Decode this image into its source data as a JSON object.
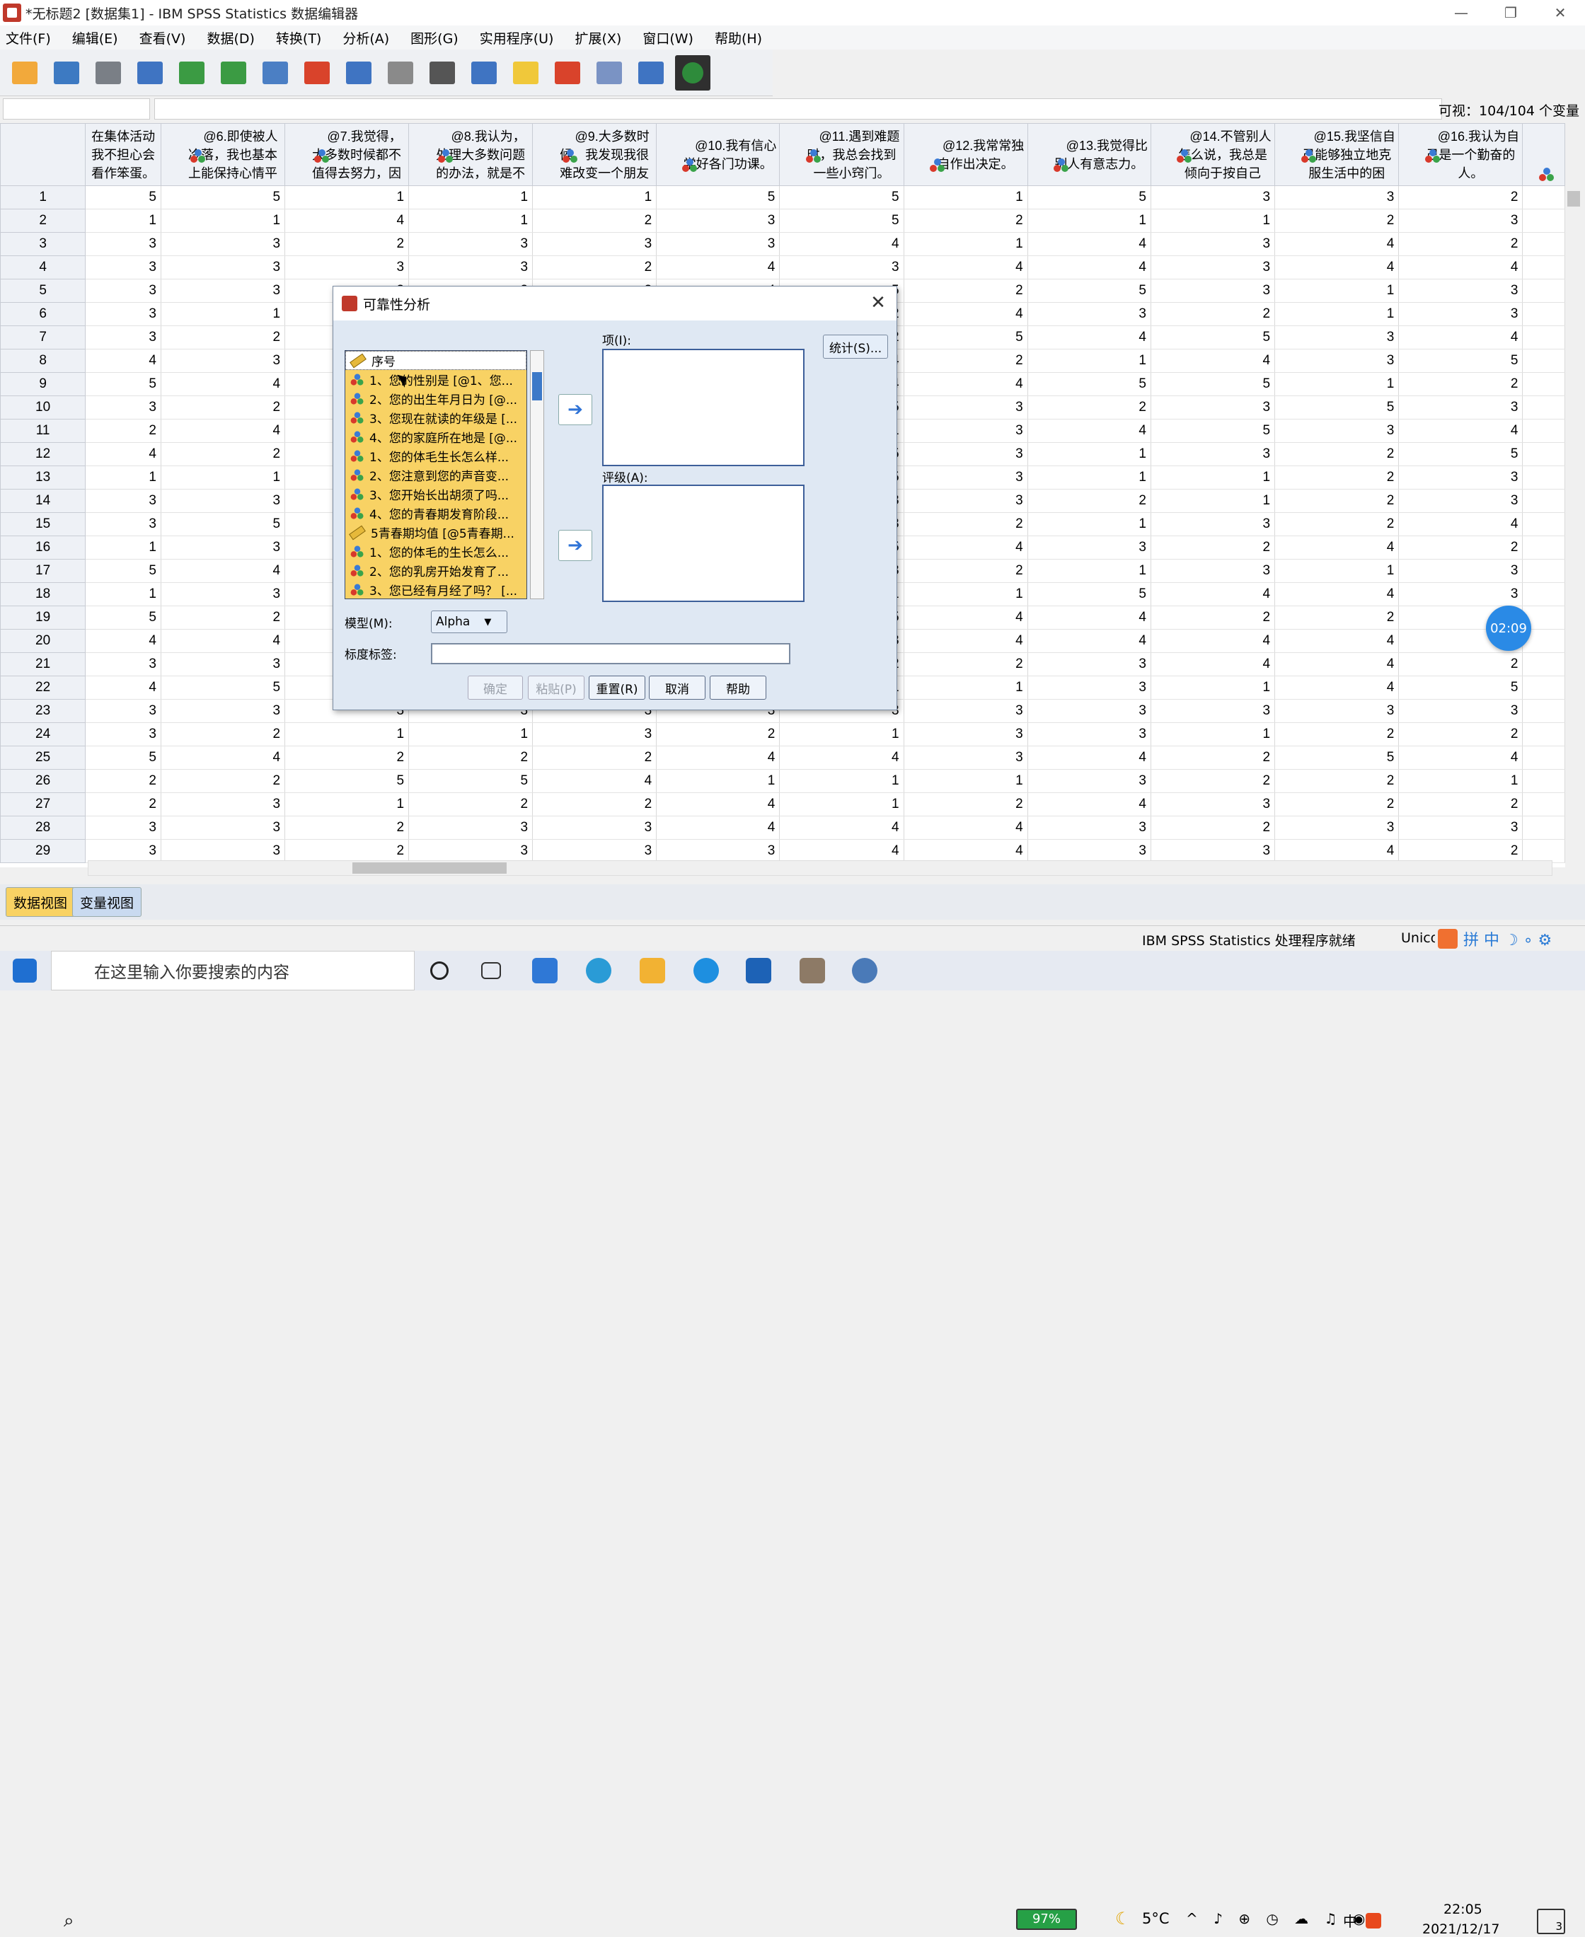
{
  "window": {
    "title": "*无标题2 [数据集1] - IBM SPSS Statistics 数据编辑器",
    "min": "—",
    "max": "❐",
    "close": "✕"
  },
  "menu": [
    "文件(F)",
    "编辑(E)",
    "查看(V)",
    "数据(D)",
    "转换(T)",
    "分析(A)",
    "图形(G)",
    "实用程序(U)",
    "扩展(X)",
    "窗口(W)",
    "帮助(H)"
  ],
  "toolbar_icons": [
    "open-icon",
    "save-icon",
    "print-icon",
    "recall-dialog-icon",
    "undo-icon",
    "redo-icon",
    "goto-case-icon",
    "goto-variable-icon",
    "variables-icon",
    "run-descriptives-icon",
    "find-icon",
    "insert-cases-icon",
    "insert-variable-icon",
    "split-file-icon",
    "weight-cases-icon",
    "select-cases-icon",
    "value-labels-icon"
  ],
  "cellbar": {
    "visible": "可视：104/104 个变量"
  },
  "columns": [
    "在集体活动我不担心会看作笨蛋。",
    "@6.即使被人冷落，我也基本上能保持心情平",
    "@7.我觉得，大多数时候都不值得去努力，因",
    "@8.我认为，处理大多数问题的办法，就是不",
    "@9.大多数时候，我发现我很难改变一个朋友",
    "@10.我有信心学好各门功课。",
    "@11.遇到难题时，我总会找到一些小窍门。",
    "@12.我常常独自作出决定。",
    "@13.我觉得比别人有意志力。",
    "@14.不管别人怎么说，我总是倾向于按自己",
    "@15.我坚信自己能够独立地克服生活中的困",
    "@16.我认为自己是一个勤奋的人。"
  ],
  "rows": [
    [
      5,
      5,
      1,
      1,
      1,
      5,
      5,
      1,
      5,
      3,
      3,
      2
    ],
    [
      1,
      1,
      4,
      1,
      2,
      3,
      5,
      2,
      1,
      1,
      2,
      3
    ],
    [
      3,
      3,
      2,
      3,
      3,
      3,
      4,
      1,
      4,
      3,
      4,
      2
    ],
    [
      3,
      3,
      3,
      3,
      2,
      4,
      3,
      4,
      4,
      3,
      4,
      4
    ],
    [
      3,
      3,
      3,
      3,
      3,
      4,
      5,
      2,
      5,
      3,
      1,
      3
    ],
    [
      3,
      1,
      3,
      3,
      3,
      3,
      2,
      4,
      3,
      2,
      1,
      3
    ],
    [
      3,
      2,
      3,
      3,
      3,
      3,
      2,
      5,
      4,
      5,
      3,
      4
    ],
    [
      4,
      3,
      3,
      3,
      3,
      3,
      4,
      2,
      1,
      4,
      3,
      5
    ],
    [
      5,
      4,
      3,
      3,
      3,
      3,
      4,
      4,
      5,
      5,
      1,
      2
    ],
    [
      3,
      2,
      3,
      3,
      3,
      3,
      5,
      3,
      2,
      3,
      5,
      3
    ],
    [
      2,
      4,
      3,
      3,
      3,
      3,
      1,
      3,
      4,
      5,
      3,
      4
    ],
    [
      4,
      2,
      3,
      3,
      3,
      3,
      5,
      3,
      1,
      3,
      2,
      5
    ],
    [
      1,
      1,
      3,
      3,
      3,
      3,
      5,
      3,
      1,
      1,
      2,
      3
    ],
    [
      3,
      3,
      3,
      3,
      3,
      3,
      3,
      3,
      2,
      1,
      2,
      3
    ],
    [
      3,
      5,
      3,
      3,
      3,
      3,
      3,
      2,
      1,
      3,
      2,
      4
    ],
    [
      1,
      3,
      3,
      3,
      3,
      3,
      5,
      4,
      3,
      2,
      4,
      2
    ],
    [
      5,
      4,
      3,
      3,
      3,
      3,
      3,
      2,
      1,
      3,
      1,
      3
    ],
    [
      1,
      3,
      3,
      3,
      3,
      3,
      1,
      1,
      5,
      4,
      4,
      3
    ],
    [
      5,
      2,
      3,
      3,
      3,
      3,
      5,
      4,
      4,
      2,
      2,
      2
    ],
    [
      4,
      4,
      3,
      3,
      3,
      3,
      3,
      4,
      4,
      4,
      4,
      2
    ],
    [
      3,
      3,
      3,
      3,
      3,
      3,
      2,
      2,
      3,
      4,
      4,
      2
    ],
    [
      4,
      5,
      3,
      3,
      3,
      3,
      1,
      1,
      3,
      1,
      4,
      5
    ],
    [
      3,
      3,
      3,
      3,
      3,
      3,
      3,
      3,
      3,
      3,
      3,
      3
    ],
    [
      3,
      2,
      1,
      1,
      3,
      2,
      1,
      3,
      3,
      1,
      2,
      2
    ],
    [
      5,
      4,
      2,
      2,
      2,
      4,
      4,
      3,
      4,
      2,
      5,
      4
    ],
    [
      2,
      2,
      5,
      5,
      4,
      1,
      1,
      1,
      3,
      2,
      2,
      1
    ],
    [
      2,
      3,
      1,
      2,
      2,
      4,
      1,
      2,
      4,
      3,
      2,
      2
    ],
    [
      3,
      3,
      2,
      3,
      3,
      4,
      4,
      4,
      3,
      2,
      3,
      3
    ],
    [
      3,
      3,
      2,
      3,
      3,
      3,
      4,
      4,
      3,
      3,
      4,
      2
    ]
  ],
  "tabs": {
    "data_view": "数据视图",
    "variable_view": "变量视图"
  },
  "status": {
    "processor": "IBM SPSS Statistics 处理程序就绪",
    "encoding": "Unico"
  },
  "dialog": {
    "title": "可靠性分析",
    "close": "✕",
    "vars": [
      {
        "label": "序号",
        "icon": "scale-ruler-icon"
      },
      {
        "label": "1、您的性别是 [@1、您...",
        "icon": "nominal-icon"
      },
      {
        "label": "2、您的出生年月日为 [@...",
        "icon": "string-nominal-icon"
      },
      {
        "label": "3、您现在就读的年级是 [...",
        "icon": "nominal-icon"
      },
      {
        "label": "4、您的家庭所在地是 [@...",
        "icon": "nominal-icon"
      },
      {
        "label": "1、您的体毛生长怎么样...",
        "icon": "nominal-icon"
      },
      {
        "label": "2、您注意到您的声音变...",
        "icon": "nominal-icon"
      },
      {
        "label": "3、您开始长出胡须了吗...",
        "icon": "nominal-icon"
      },
      {
        "label": "4、您的青春期发育阶段...",
        "icon": "nominal-icon"
      },
      {
        "label": "5青春期均值 [@5青春期...",
        "icon": "scale-ruler-icon"
      },
      {
        "label": "1、您的体毛的生长怎么...",
        "icon": "nominal-icon"
      },
      {
        "label": "2、您的乳房开始发育了...",
        "icon": "nominal-icon"
      },
      {
        "label": "3、您已经有月经了吗？ [...",
        "icon": "nominal-icon"
      }
    ],
    "items_label": "项(I):",
    "ratings_label": "评级(A):",
    "statistics": "统计(S)...",
    "model_label": "模型(M):",
    "model_value": "Alpha",
    "scale_label": "标度标签:",
    "scale_value": "",
    "buttons": {
      "ok": "确定",
      "paste": "粘贴(P)",
      "reset": "重置(R)",
      "cancel": "取消",
      "help": "帮助"
    }
  },
  "timer": "02:09",
  "taskbar": {
    "search_placeholder": "在这里输入你要搜索的内容",
    "battery": "97%",
    "temp": "5°C",
    "time": "22:05",
    "date": "2021/12/17",
    "notif": "3",
    "ime": "中"
  }
}
